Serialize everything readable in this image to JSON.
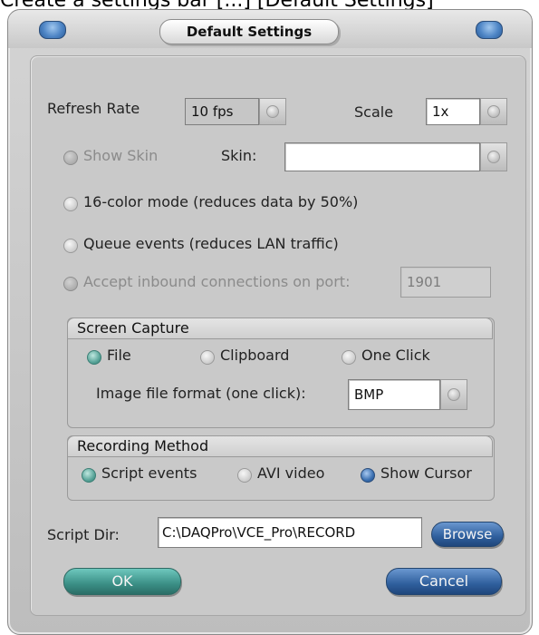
{
  "caption": {
    "text": "Create a settings bar [...] [Default Settings]"
  },
  "window": {
    "title": "Default Settings",
    "accent_blue": "#3a6fb0",
    "accent_teal": "#4a9f94"
  },
  "refresh": {
    "label": "Refresh Rate",
    "value": "10 fps"
  },
  "scale": {
    "label": "Scale",
    "value": "1x"
  },
  "skin": {
    "show_label": "Show Skin",
    "label": "Skin:",
    "value": ""
  },
  "options": {
    "color16_label": "16-color mode (reduces data by 50%)",
    "queue_label": "Queue events (reduces LAN traffic)",
    "inbound_label": "Accept inbound connections on port:",
    "port_value": "1901"
  },
  "screen_capture": {
    "title": "Screen Capture",
    "file_label": "File",
    "clipboard_label": "Clipboard",
    "one_click_label": "One Click",
    "selected": "File",
    "format_label": "Image file format (one click):",
    "format_value": "BMP"
  },
  "recording": {
    "title": "Recording Method",
    "script_label": "Script events",
    "avi_label": "AVI video",
    "cursor_label": "Show Cursor",
    "selected": "Script events",
    "show_cursor": true
  },
  "script_dir": {
    "label": "Script Dir:",
    "value": "C:\\DAQPro\\VCE_Pro\\RECORD",
    "browse_label": "Browse"
  },
  "buttons": {
    "ok_label": "OK",
    "cancel_label": "Cancel"
  }
}
